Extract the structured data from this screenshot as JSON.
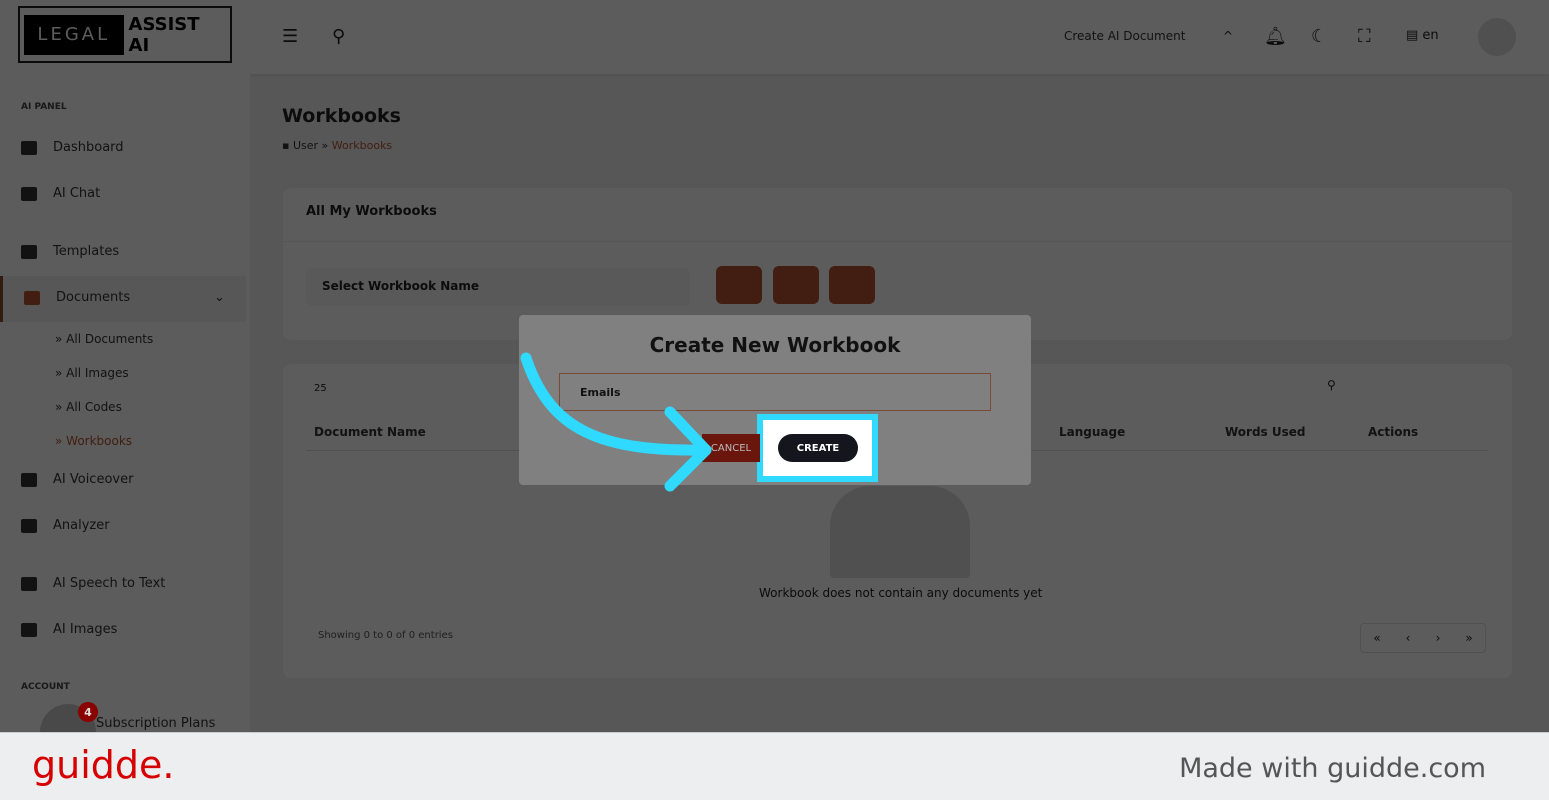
{
  "header": {
    "logo_left": "LEGAL",
    "logo_right": "ASSIST AI",
    "create_doc": "Create AI Document",
    "lang": "en"
  },
  "sidebar": {
    "section1": "AI PANEL",
    "items": [
      "Dashboard",
      "AI Chat",
      "Templates",
      "Documents",
      "AI Voiceover",
      "Analyzer",
      "AI Speech to Text",
      "AI Images"
    ],
    "sub": [
      "All Documents",
      "All Images",
      "All Codes",
      "Workbooks"
    ],
    "section2": "ACCOUNT",
    "partial": "Subscription Plans",
    "badge": "4"
  },
  "main": {
    "title": "Workbooks",
    "crumb_user": "User",
    "crumb_sep": "»",
    "crumb_current": "Workbooks",
    "card_title": "All My Workbooks",
    "select": "Select Workbook Name",
    "page_size": "25",
    "columns": [
      "Document Name",
      "Language",
      "Words Used",
      "Actions"
    ],
    "empty": "Workbook does not contain any documents yet",
    "showing": "Showing 0 to 0 of 0 entries",
    "pager": [
      "«",
      "‹",
      "›",
      "»"
    ]
  },
  "modal": {
    "title": "Create New Workbook",
    "input_value": "Emails",
    "cancel": "CANCEL",
    "create": "CREATE"
  },
  "footer": {
    "brand": "guidde.",
    "made": "Made with guidde.com"
  },
  "colors": {
    "accent": "#b5532e",
    "highlight": "#2fd9ff",
    "brand": "#d60000"
  }
}
